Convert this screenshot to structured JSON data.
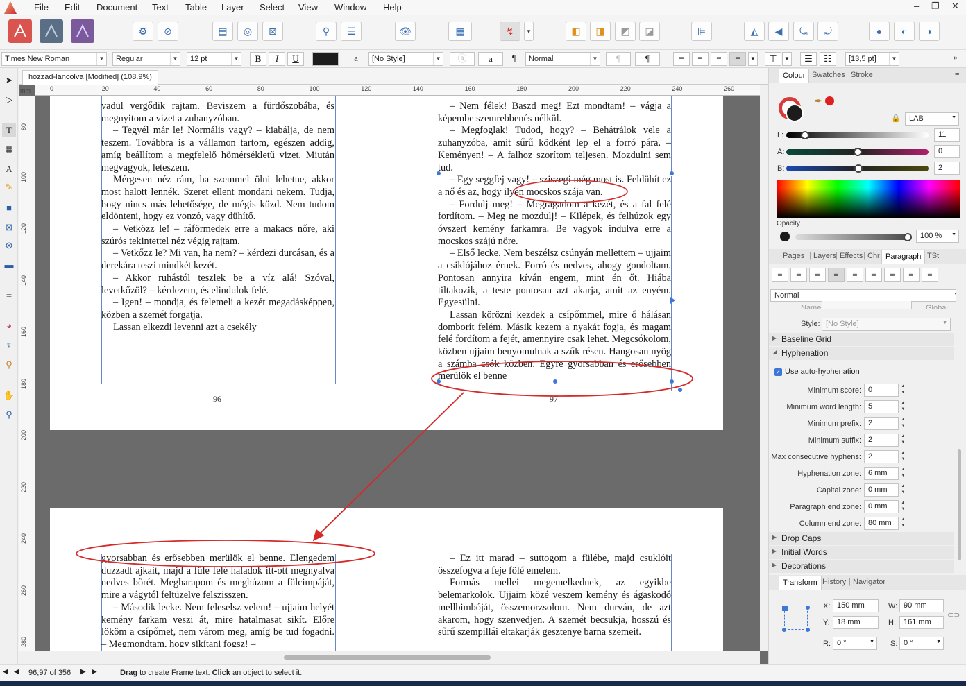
{
  "menu": [
    "File",
    "Edit",
    "Document",
    "Text",
    "Table",
    "Layer",
    "Select",
    "View",
    "Window",
    "Help"
  ],
  "window_controls": [
    "–",
    "❐",
    "✕"
  ],
  "context": {
    "font": "Times New Roman",
    "weight": "Regular",
    "size": "12 pt",
    "bold": "B",
    "italic": "I",
    "underline": "U",
    "char_style": "[No Style]",
    "para_style": "Normal",
    "spacing": "[13,5 pt]",
    "a1": "a",
    "a2": "a",
    "pilcrow": "¶"
  },
  "document": {
    "tab_title": "hozzad-lancolva [Modified] (108.9%)",
    "ruler_unit": "mm",
    "h_ruler": [
      "0",
      "20",
      "40",
      "60",
      "80",
      "100",
      "120",
      "140",
      "160",
      "180",
      "200",
      "220",
      "240",
      "260"
    ],
    "v_ruler": [
      "80",
      "100",
      "120",
      "140",
      "160",
      "180",
      "200",
      "220",
      "240",
      "260",
      "280"
    ],
    "page_96": {
      "number": "96",
      "paragraphs": [
        "vadul vergődik rajtam. Beviszem a fürdőszobába, és megnyitom a vizet a zuhanyzóban.",
        "– Tegyél már le! Normális vagy? – kiabálja, de nem teszem. Továbbra is a vállamon tartom, egészen addig, amíg beállítom a megfelelő hőmérsékletű vizet. Miután megvagyok, leteszem.",
        "Mérgesen néz rám, ha szemmel ölni lehetne, akkor most halott lennék. Szeret ellent mondani nekem. Tudja, hogy nincs más lehetősége, de mégis küzd. Nem tudom eldönteni, hogy ez vonzó, vagy dühítő.",
        "– Vetközz le! – ráförmedek erre a makacs nőre, aki szúrós tekintettel néz végig rajtam.",
        "– Vetkőzz le? Mi van, ha nem? – kérdezi durcásan, és a derekára teszi mindkét kezét.",
        "– Akkor ruhástól teszlek be a víz alá! Szóval, levetkőzöl? – kérdezem, és elindulok felé.",
        "– Igen! – mondja, és felemeli a kezét megadásképpen, közben a szemét forgatja.",
        "Lassan elkezdi levenni azt a csekély"
      ]
    },
    "page_97": {
      "number": "97",
      "paragraphs": [
        "– Nem félek! Baszd meg! Ezt mondtam! – vágja a képembe szemrebbenés nélkül.",
        "– Megfoglak! Tudod, hogy? – Behátrálok vele a zuhanyzóba, amit sűrű ködként lep el a forró pára. – Keményen! – A falhoz szorítom teljesen. Mozdulni sem tud.",
        "– Egy seggfej vagy! – sziszegi még most is. Feldühít ez a nő és az, hogy ilyen mocskos szája van.",
        "– Fordulj meg! – Megragadom a kezét, és a fal felé fordítom. – Meg ne mozdulj! – Kilépek, és felhúzok egy óvszert kemény farkamra. Be vagyok indulva erre a mocskos szájú nőre.",
        "– Első lecke. Nem beszélsz csúnyán mellettem – ujjaim a csiklójához érnek. Forró és nedves, ahogy gondoltam. Pontosan annyira kíván engem, mint én őt. Hiába tiltakozik, a teste pontosan azt akarja, amit az enyém. Egyesülni.",
        "Lassan körözni kezdek a csípőmmel, mire ő hálásan domborít felém. Másik kezem a nyakát fogja, és magam felé fordítom a fejét, amennyire csak lehet. Megcsókolom, közben ujjaim benyomulnak a szűk résen. Hangosan nyög a számba csók közben. Egyre gyorsabban és erősebben merülök el benne"
      ]
    },
    "page_98": {
      "paragraphs": [
        "gyorsabban és erősebben merülök el benne. Elengedem duzzadt ajkait, majd a füle felé haladok itt-ott megnyalva nedves bőrét. Megharapom és meghúzom a fülcimpáját, mire a vágytól feltüzelve felszisszen.",
        "– Második lecke. Nem feleselsz velem! – ujjaim helyét kemény farkam veszi át, mire hatalmasat sikít. Előre lököm a csípőmet, nem várom meg, amíg be tud fogadni. – Megmondtam, hogy sikítani fogsz! –"
      ]
    },
    "page_99": {
      "paragraphs": [
        "– Ez itt marad – suttogom a fülébe, majd csuklóit összefogva a feje fölé emelem.",
        "Formás mellei megemelkednek, az egyikbe belemarkolok. Ujjaim közé veszem kemény és ágaskodó mellbimbóját, összemorzsolom. Nem durván, de azt akarom, hogy szenvedjen. A szemét becsukja, hosszú és sűrű szempillái eltakarják gesztenye barna szemeit."
      ]
    }
  },
  "colour_panel": {
    "tabs": [
      "Colour",
      "Swatches",
      "Stroke"
    ],
    "model": "LAB",
    "channels": [
      {
        "label": "L:",
        "value": "11",
        "fraction": 0.11
      },
      {
        "label": "A:",
        "value": "0",
        "fraction": 0.5
      },
      {
        "label": "B:",
        "value": "2",
        "fraction": 0.51
      }
    ],
    "opacity_label": "Opacity",
    "opacity_value": "100 %",
    "opacity_fraction": 1.0,
    "fill_color": "#1c1c1c",
    "accent_dot_color": "#e02020"
  },
  "paragraph_panel": {
    "tabs": [
      "Pages",
      "Layers",
      "Effects",
      "Chr",
      "Paragraph",
      "TSt"
    ],
    "style_select": "Normal",
    "name_label": "Name:",
    "global_label": "Global",
    "style_label": "Style:",
    "style_value": "[No Style]",
    "sections": [
      "Baseline Grid",
      "Hyphenation",
      "Drop Caps",
      "Initial Words",
      "Decorations"
    ],
    "use_auto_hyphenation": "Use auto-hyphenation",
    "fields": [
      {
        "label": "Minimum score:",
        "value": "0"
      },
      {
        "label": "Minimum word length:",
        "value": "5"
      },
      {
        "label": "Minimum prefix:",
        "value": "2"
      },
      {
        "label": "Minimum suffix:",
        "value": "2"
      },
      {
        "label": "Max consecutive hyphens:",
        "value": "2"
      },
      {
        "label": "Hyphenation zone:",
        "value": "6 mm"
      },
      {
        "label": "Capital zone:",
        "value": "0 mm"
      },
      {
        "label": "Paragraph end zone:",
        "value": "0 mm"
      },
      {
        "label": "Column end zone:",
        "value": "80 mm"
      }
    ]
  },
  "transform_panel": {
    "tabs": [
      "Transform",
      "History",
      "Navigator"
    ],
    "x_label": "X:",
    "x": "150 mm",
    "y_label": "Y:",
    "y": "18 mm",
    "w_label": "W:",
    "w": "90 mm",
    "h_label": "H:",
    "h": "161 mm",
    "r_label": "R:",
    "r": "0 °",
    "s_label": "S:",
    "s": "0 °"
  },
  "status": {
    "pages": "96,97 of 356",
    "hint_bold1": "Drag",
    "hint1": " to create Frame text. ",
    "hint_bold2": "Click",
    "hint2": " an object to select it."
  },
  "annotation_color": "#d42a2a"
}
